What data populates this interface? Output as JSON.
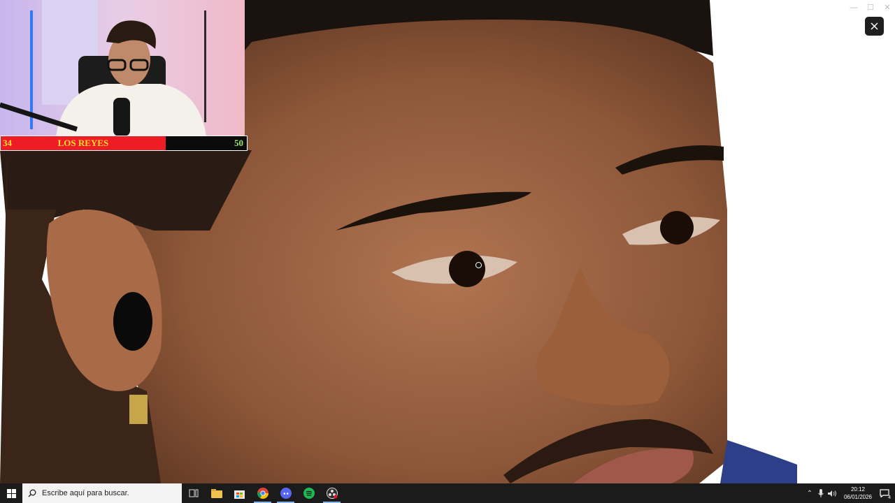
{
  "viewer": {
    "close_icon": "close-icon",
    "window_controls": [
      "minimize-icon",
      "maximize-icon",
      "close-icon"
    ]
  },
  "overlay": {
    "score_left": "34",
    "score_title": "LOS REYES",
    "score_right": "50",
    "score_fill_fraction": 0.67,
    "colors": {
      "red": "#ee1c24",
      "yellow": "#ffdd33",
      "green": "#9be86a"
    }
  },
  "taskbar": {
    "search_placeholder": "Escribe aquí para buscar.",
    "apps": [
      "task-view-icon",
      "file-explorer-icon",
      "store-icon",
      "chrome-icon",
      "discord-icon",
      "spotify-icon",
      "obs-icon"
    ],
    "time": "20:12",
    "date": "06/01/2026",
    "notification_count": "4"
  }
}
